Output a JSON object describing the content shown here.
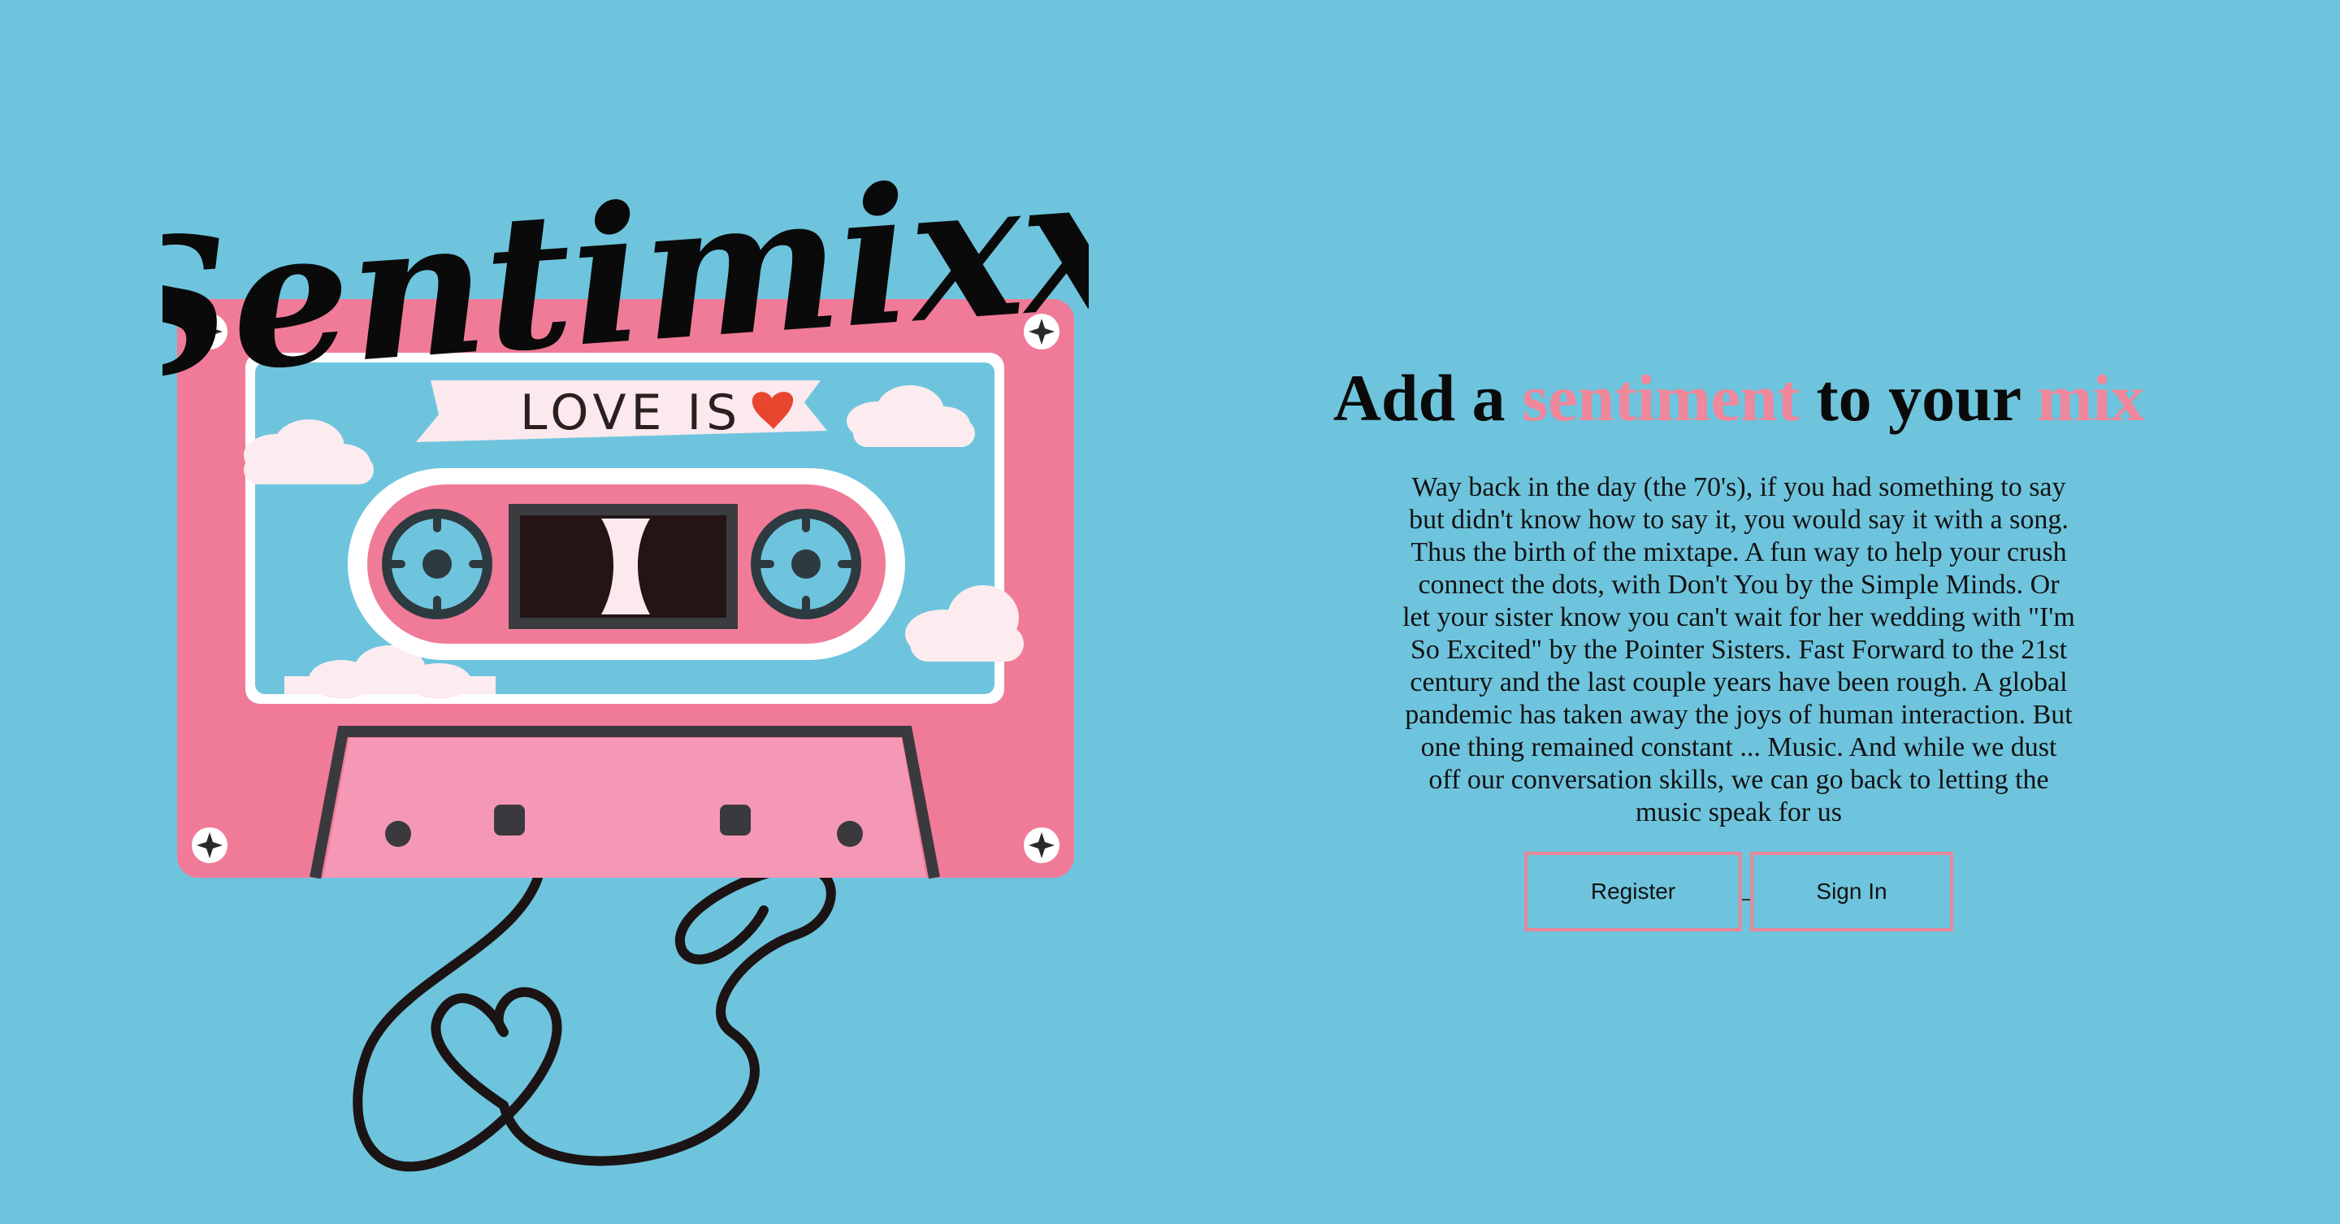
{
  "brand": {
    "logo_text": "Sentimixx",
    "cassette_label": "LOVE IS"
  },
  "headline": {
    "part1": "Add a",
    "accent1": "sentiment",
    "part2": "to your",
    "accent2": "mix"
  },
  "intro_text": "Way back in the day (the 70's), if you had something to say but didn't know how to say it, you would say it with a song. Thus the birth of the mixtape. A fun way to help your crush connect the dots, with Don't You by the Simple Minds. Or let your sister know you can't wait for her wedding with \"I'm So Excited\" by the Pointer Sisters. Fast Forward to the 21st century and the last couple years have been rough. A global pandemic has taken away the joys of human interaction. But one thing remained constant ... Music. And while we dust off our conversation skills, we can go back to letting the music speak for us",
  "actions": {
    "register_label": "Register",
    "signin_label": "Sign In"
  },
  "colors": {
    "background": "#6ec4dd",
    "accent_pink": "#f0879b",
    "cassette_pink": "#f07b98",
    "button_border": "#e8879a"
  },
  "icons": [
    "cassette-tape-illustration",
    "heart-icon",
    "screw-icon",
    "cloud-icon",
    "tape-ribbon-heart"
  ]
}
